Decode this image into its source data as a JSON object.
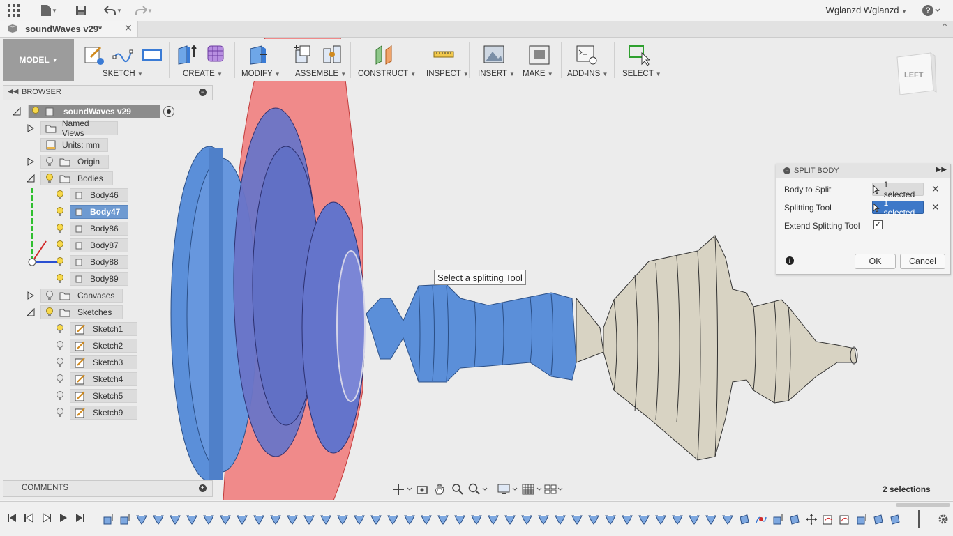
{
  "app": {
    "user_name": "Wglanzd Wglanzd",
    "tab_title": "soundWaves v29*"
  },
  "toolbar": {
    "workspace": "MODEL",
    "groups": [
      {
        "label": "SKETCH"
      },
      {
        "label": "CREATE"
      },
      {
        "label": "MODIFY"
      },
      {
        "label": "ASSEMBLE"
      },
      {
        "label": "CONSTRUCT"
      },
      {
        "label": "INSPECT"
      },
      {
        "label": "INSERT"
      },
      {
        "label": "MAKE"
      },
      {
        "label": "ADD-INS"
      },
      {
        "label": "SELECT"
      }
    ]
  },
  "viewcube": {
    "face": "LEFT"
  },
  "browser": {
    "title": "BROWSER",
    "root": "soundWaves v29",
    "named_views": "Named Views",
    "units": "Units: mm",
    "origin": "Origin",
    "bodies_label": "Bodies",
    "bodies": [
      "Body46",
      "Body47",
      "Body86",
      "Body87",
      "Body88",
      "Body89"
    ],
    "selected_body": "Body47",
    "canvases": "Canvases",
    "sketches_label": "Sketches",
    "sketches": [
      "Sketch1",
      "Sketch2",
      "Sketch3",
      "Sketch4",
      "Sketch5",
      "Sketch9"
    ]
  },
  "comments": {
    "title": "COMMENTS"
  },
  "dialog": {
    "title": "SPLIT BODY",
    "body_to_split_label": "Body to Split",
    "body_to_split_value": "1 selected",
    "splitting_tool_label": "Splitting Tool",
    "splitting_tool_value": "1 selected",
    "extend_label": "Extend Splitting Tool",
    "extend_checked": true,
    "ok": "OK",
    "cancel": "Cancel"
  },
  "tooltip": "Select a splitting Tool",
  "status": {
    "selections": "2 selections"
  },
  "colors": {
    "blue_body": "#5b8fd9",
    "red_plane": "#f08a8a",
    "beige_body": "#d8d3c3",
    "selected_node": "#6e9ad1"
  }
}
